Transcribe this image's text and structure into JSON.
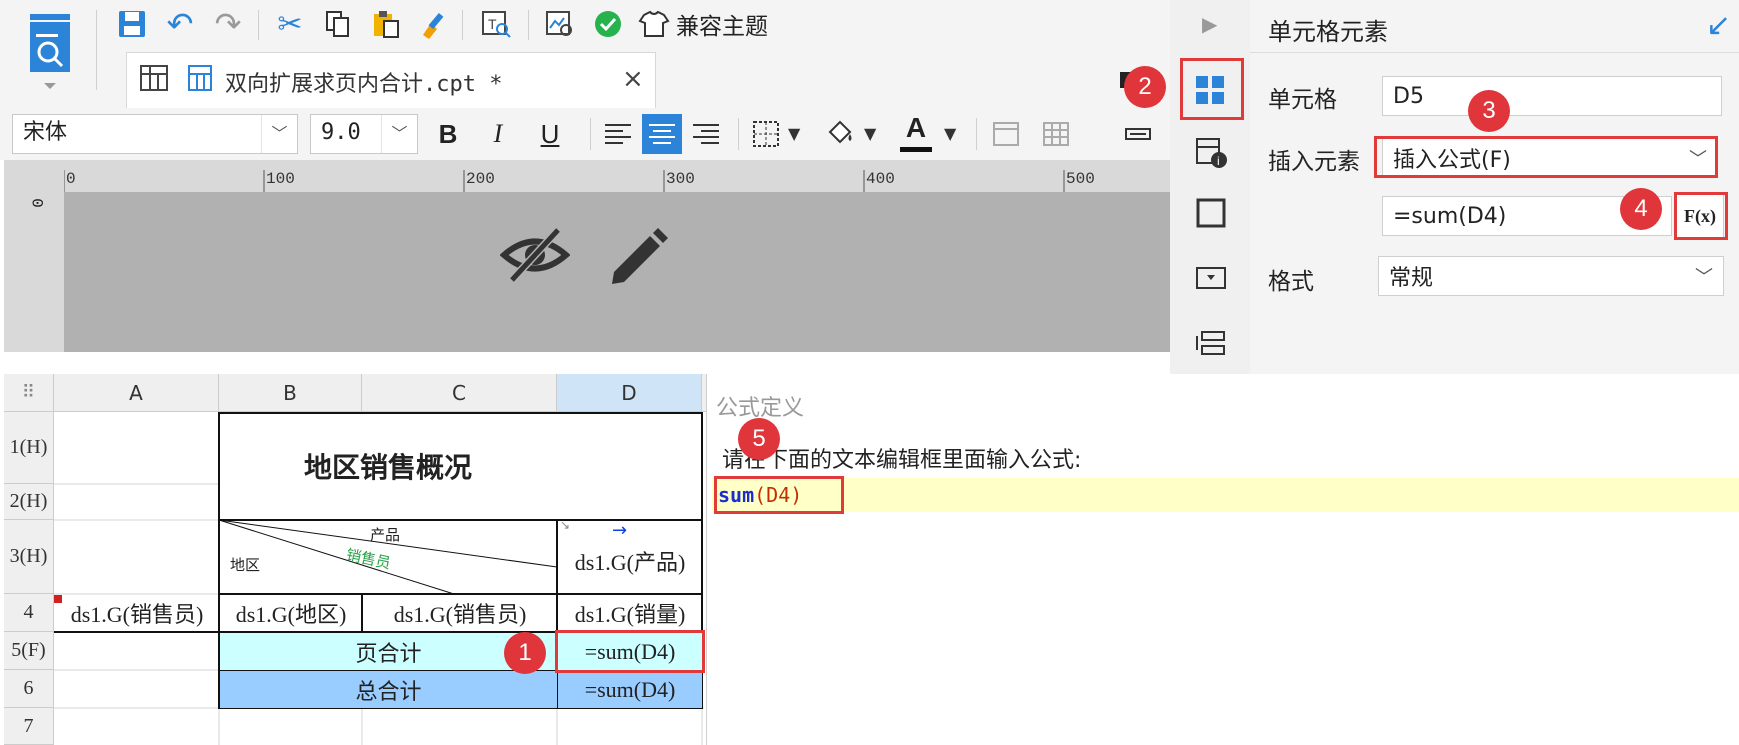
{
  "toolbar": {
    "compat_theme_label": "兼容主题"
  },
  "tab": {
    "label": "双向扩展求页内合计.cpt *",
    "close": "×"
  },
  "format_bar": {
    "font_family": "宋体",
    "font_size": "9.0",
    "bold": "B",
    "italic": "I",
    "underline": "U",
    "font_color_glyph": "A"
  },
  "ruler": {
    "ticks": [
      "0",
      "100",
      "200",
      "300",
      "400",
      "500"
    ],
    "left_tick": "0"
  },
  "sheet": {
    "columns": [
      "A",
      "B",
      "C",
      "D"
    ],
    "rows": [
      "1(H)",
      "2(H)",
      "3(H)",
      "4",
      "5(F)",
      "6",
      "7"
    ],
    "title": "地区销售概况",
    "slash_header": {
      "product": "产品",
      "salesperson": "销售员",
      "region": "地区"
    },
    "d3": "ds1.G(产品)",
    "row4": [
      "ds1.G(销售员)",
      "ds1.G(地区)",
      "ds1.G(销售员)",
      "ds1.G(销量)"
    ],
    "page_total_label": "页合计",
    "page_total_formula": "=sum(D4)",
    "grand_total_label": "总合计",
    "grand_total_formula": "=sum(D4)"
  },
  "panel": {
    "title": "单元格元素",
    "cell_label": "单元格",
    "cell_value": "D5",
    "insert_label": "插入元素",
    "insert_value": "插入公式(F)",
    "formula_value": "=sum(D4)",
    "fx_button": "F(x)",
    "format_label": "格式",
    "format_value": "常规"
  },
  "dialog": {
    "title": "公式定义",
    "instruction": "请在下面的文本编辑框里面输入公式:",
    "formula_func": "sum",
    "formula_args": "(D4)"
  },
  "callouts": [
    "1",
    "2",
    "3",
    "4",
    "5"
  ],
  "colors": {
    "accent_blue": "#1e7fe0",
    "callout_red": "#e0353a",
    "page_total_bg": "#ccffff",
    "grand_total_bg": "#99ccff",
    "editor_line_bg": "#ffffc8"
  }
}
